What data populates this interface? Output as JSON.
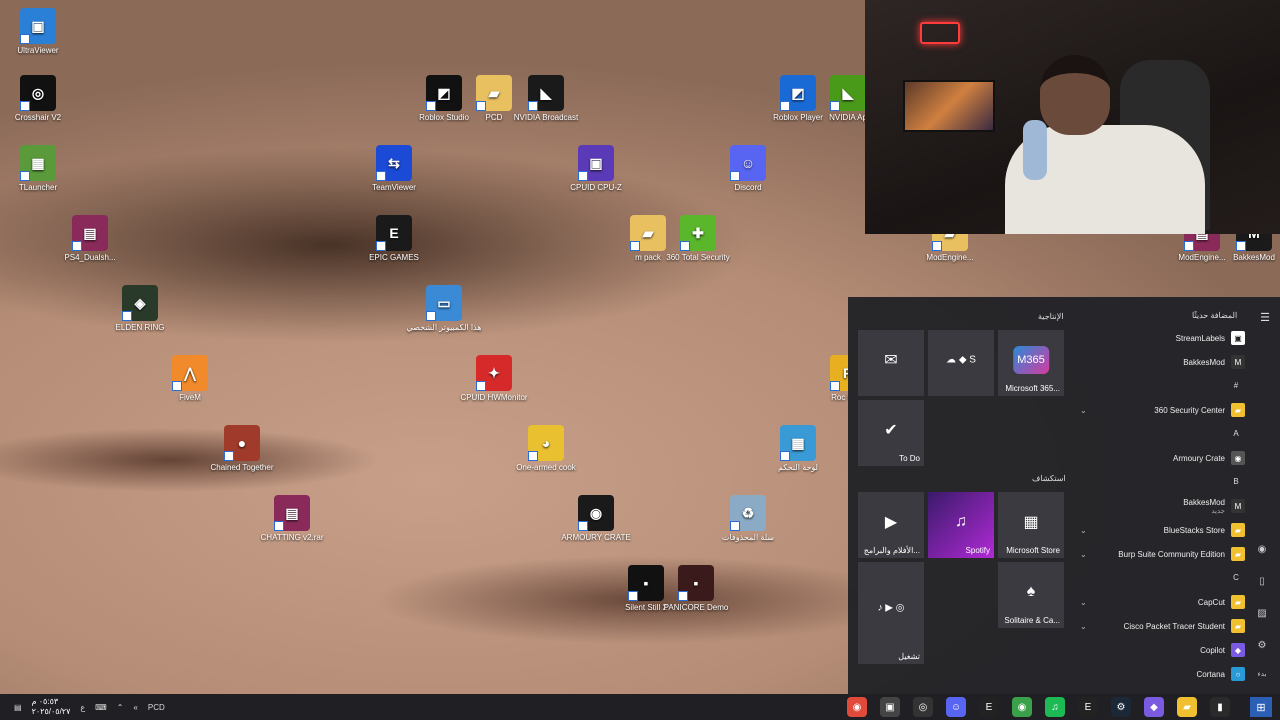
{
  "desktop_icons": [
    {
      "label": "UltraViewer",
      "glyph": "▣",
      "color": "#2a7fd6"
    },
    {
      "label": "Crosshair V2",
      "glyph": "◎",
      "color": "#111111"
    },
    {
      "label": "TLauncher",
      "glyph": "▦",
      "color": "#5a9a3a"
    },
    {
      "label": "PS4_Dualsh...",
      "glyph": "▤",
      "color": "#8a2a5a"
    },
    {
      "label": "ELDEN RING",
      "glyph": "◈",
      "color": "#2a3a2a"
    },
    {
      "label": "FiveM",
      "glyph": "⋀",
      "color": "#f08a2a"
    },
    {
      "label": "Chained Together",
      "glyph": "●",
      "color": "#a03a2a"
    },
    {
      "label": "CHATTING v2.rar",
      "glyph": "▤",
      "color": "#8a2a5a"
    },
    {
      "label": "Roblox Studio",
      "glyph": "◩",
      "color": "#111111"
    },
    {
      "label": "PCD",
      "glyph": "▰",
      "color": "#e8c060"
    },
    {
      "label": "NVIDIA Broadcast",
      "glyph": "◣",
      "color": "#1a1a1a"
    },
    {
      "label": "TeamViewer",
      "glyph": "⇆",
      "color": "#1a4ad6"
    },
    {
      "label": "CPUID CPU-Z",
      "glyph": "▣",
      "color": "#5a3ab6"
    },
    {
      "label": "Discord",
      "glyph": "☺",
      "color": "#5865f2"
    },
    {
      "label": "EPIC GAMES",
      "glyph": "E",
      "color": "#1a1a1a"
    },
    {
      "label": "m pack",
      "glyph": "▰",
      "color": "#e8c060"
    },
    {
      "label": "360 Total Security",
      "glyph": "✚",
      "color": "#5ab62a"
    },
    {
      "label": "هذا الكمبيوتر الشخصي",
      "glyph": "▭",
      "color": "#3a8ad6"
    },
    {
      "label": "CPUID HWMonitor",
      "glyph": "✦",
      "color": "#d62a2a"
    },
    {
      "label": "One-armed cook",
      "glyph": "◕",
      "color": "#e8c030"
    },
    {
      "label": "لوحة التحكم",
      "glyph": "▦",
      "color": "#3a9ad6"
    },
    {
      "label": "ARMOURY CRATE",
      "glyph": "◉",
      "color": "#1a1a1a"
    },
    {
      "label": "سلة المحذوفات",
      "glyph": "♻",
      "color": "#8aaac6"
    },
    {
      "label": "Silent Still 2",
      "glyph": "▪",
      "color": "#111111"
    },
    {
      "label": "PANICORE Demo",
      "glyph": "▪",
      "color": "#3a1a1a"
    },
    {
      "label": "Roblox Player",
      "glyph": "◩",
      "color": "#1a6ad6"
    },
    {
      "label": "NVIDIA Ap",
      "glyph": "◣",
      "color": "#4a9a1a"
    },
    {
      "label": "Roc Gam",
      "glyph": "R",
      "color": "#e8b020"
    },
    {
      "label": "ModEngine...",
      "glyph": "▰",
      "color": "#e8c060"
    },
    {
      "label": "ModEngine...",
      "glyph": "▤",
      "color": "#8a2a5a"
    },
    {
      "label": "BakkesMod",
      "glyph": "M",
      "color": "#1a1a1a"
    }
  ],
  "start_menu": {
    "pinned_header": "الإنتاجية",
    "explore_header": "استكشاف",
    "recent_header": "المضافة حديثًا",
    "tiles": [
      {
        "label": "",
        "glyph": "✉"
      },
      {
        "label": "",
        "glyph": "☁ ◆ S"
      },
      {
        "label": "Microsoft 365...",
        "glyph": "M365"
      },
      {
        "label": "To Do",
        "glyph": "✔"
      },
      {
        "label": "الأفلام والبرامج...",
        "glyph": "▶"
      },
      {
        "label": "Spotify",
        "glyph": "♫"
      },
      {
        "label": "Microsoft Store",
        "glyph": "▦"
      },
      {
        "label": "تشغيل",
        "glyph": "♪ ▶ ◎"
      },
      {
        "label": "Solitaire & Ca...",
        "glyph": "♠"
      }
    ],
    "apps": [
      {
        "label": "StreamLabels",
        "glyph": "▣",
        "color": "#ffffff",
        "chev": false
      },
      {
        "label": "BakkesMod",
        "glyph": "M",
        "color": "#333333",
        "chev": false
      },
      {
        "label": "360 Security Center",
        "glyph": "▰",
        "color": "#f0c030",
        "chev": true
      },
      {
        "label": "Armoury Crate",
        "glyph": "◉",
        "color": "#555555",
        "chev": false
      },
      {
        "label": "BakkesMod",
        "glyph": "M",
        "color": "#333333",
        "chev": false,
        "sub": "جديد"
      },
      {
        "label": "BlueStacks Store",
        "glyph": "▰",
        "color": "#f0c030",
        "chev": true
      },
      {
        "label": "Burp Suite Community Edition",
        "glyph": "▰",
        "color": "#f0c030",
        "chev": true
      },
      {
        "label": "CapCut",
        "glyph": "▰",
        "color": "#f0c030",
        "chev": true
      },
      {
        "label": "Cisco Packet Tracer Student",
        "glyph": "▰",
        "color": "#f0c030",
        "chev": true
      },
      {
        "label": "Copilot",
        "glyph": "◆",
        "color": "#7a5ae0",
        "chev": false
      },
      {
        "label": "Cortana",
        "glyph": "○",
        "color": "#2a9ad6",
        "chev": false
      }
    ],
    "letters": [
      "#",
      "A",
      "B",
      "C"
    ],
    "power_label": "بدء"
  },
  "taskbar": {
    "time": "٠٥:٥٣ م",
    "date": "٢٠٢٥/٠٥/٢٧",
    "lang": "ع",
    "desk_label": "PCD",
    "apps": [
      {
        "name": "chrome",
        "glyph": "◉",
        "color": "#e04a3a"
      },
      {
        "name": "streamlabels",
        "glyph": "▣",
        "color": "#444444"
      },
      {
        "name": "obs",
        "glyph": "◎",
        "color": "#333333"
      },
      {
        "name": "discord",
        "glyph": "☺",
        "color": "#5865f2"
      },
      {
        "name": "epic",
        "glyph": "E",
        "color": "#222222"
      },
      {
        "name": "chrome-2",
        "glyph": "◉",
        "color": "#3aa04a"
      },
      {
        "name": "spotify",
        "glyph": "♫",
        "color": "#1db954"
      },
      {
        "name": "epic-2",
        "glyph": "E",
        "color": "#222222"
      },
      {
        "name": "steam",
        "glyph": "⚙",
        "color": "#1b2838"
      },
      {
        "name": "copilot",
        "glyph": "◆",
        "color": "#7a5ae0"
      },
      {
        "name": "explorer",
        "glyph": "▰",
        "color": "#f0c030"
      },
      {
        "name": "terminal",
        "glyph": "▮",
        "color": "#2a2a2a"
      }
    ],
    "start_glyph": "⊞"
  }
}
